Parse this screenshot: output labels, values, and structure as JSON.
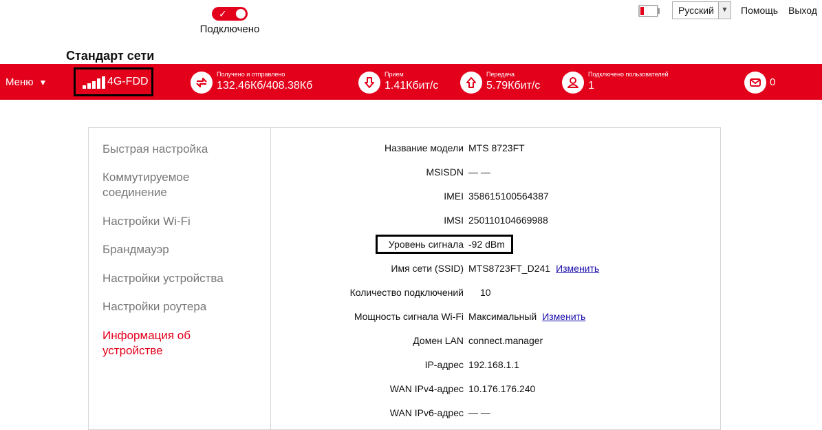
{
  "header": {
    "connection_toggle_label": "Подключено",
    "language": "Русский",
    "help_label": "Помощь",
    "logout_label": "Выход",
    "network_standard_title": "Стандарт сети"
  },
  "status_bar": {
    "menu_label": "Меню",
    "network_type": "4G-FDD",
    "received_sent_label": "Получено и отправлено",
    "received_sent_value": "132.46Кб/408.38Кб",
    "download_label": "Прием",
    "download_value": "1.41Кбит/с",
    "upload_label": "Передача",
    "upload_value": "5.79Кбит/с",
    "users_label": "Подключено пользователей",
    "users_value": "1",
    "messages_count": "0"
  },
  "sidebar": {
    "items": [
      {
        "label": "Быстрая настройка"
      },
      {
        "label": "Коммутируемое соединение"
      },
      {
        "label": "Настройки Wi-Fi"
      },
      {
        "label": "Брандмауэр"
      },
      {
        "label": "Настройки устройства"
      },
      {
        "label": "Настройки роутера"
      },
      {
        "label": "Информация об устройстве"
      }
    ]
  },
  "device_info": {
    "rows": [
      {
        "key": "Название модели",
        "value": "MTS 8723FT"
      },
      {
        "key": "MSISDN",
        "value": "— —"
      },
      {
        "key": "IMEI",
        "value": "358615100564387"
      },
      {
        "key": "IMSI",
        "value": "250110104669988"
      },
      {
        "key": "Уровень сигнала",
        "value": "-92 dBm"
      },
      {
        "key": "Имя сети (SSID)",
        "value": "MTS8723FT_D241",
        "edit": "Изменить"
      },
      {
        "key": "Количество подключений",
        "value": "10"
      },
      {
        "key": "Мощность сигнала Wi-Fi",
        "value": "Максимальный",
        "edit": "Изменить"
      },
      {
        "key": "Домен LAN",
        "value": "connect.manager"
      },
      {
        "key": "IP-адрес",
        "value": "192.168.1.1"
      },
      {
        "key": "WAN IPv4-адрес",
        "value": "10.176.176.240"
      },
      {
        "key": "WAN IPv6-адрес",
        "value": "— —"
      }
    ]
  },
  "colors": {
    "brand_red": "#e3001b",
    "link_blue": "#1a0dab"
  },
  "icons": [
    "check-icon",
    "battery-icon",
    "chevron-down-icon",
    "signal-bars-icon",
    "transfer-icon",
    "download-icon",
    "upload-icon",
    "users-icon",
    "mail-icon"
  ]
}
